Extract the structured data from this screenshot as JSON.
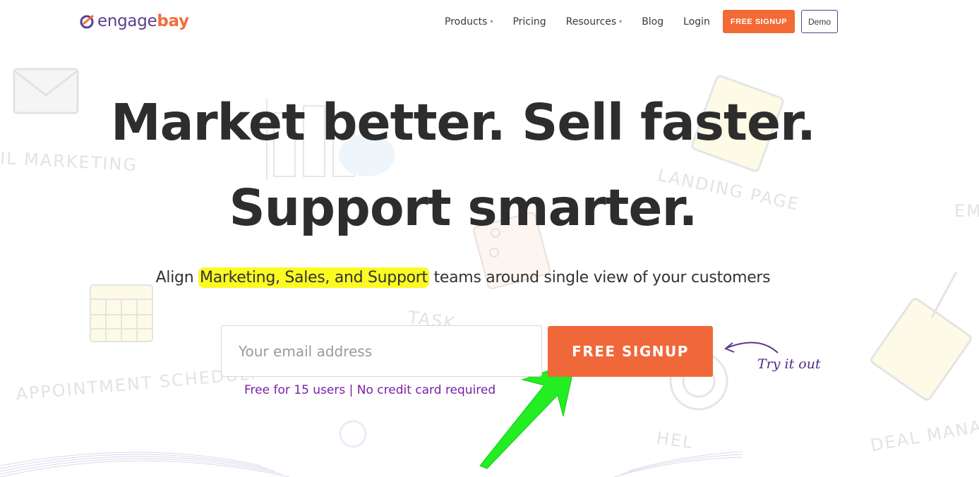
{
  "brand": {
    "name_part1": "engage",
    "name_part2": "bay"
  },
  "nav": {
    "items": [
      {
        "label": "Products",
        "dropdown": true
      },
      {
        "label": "Pricing",
        "dropdown": false
      },
      {
        "label": "Resources",
        "dropdown": true
      },
      {
        "label": "Blog",
        "dropdown": false
      },
      {
        "label": "Login",
        "dropdown": false
      }
    ],
    "caret": "▾",
    "signup_label": "FREE SIGNUP",
    "demo_label": "Demo"
  },
  "hero": {
    "headline_line1": "Market better. Sell faster.",
    "headline_line2": "Support smarter.",
    "sub_before": "Align ",
    "sub_highlight": "Marketing, Sales, and Support",
    "sub_after": " teams around single view of your customers",
    "email_placeholder": "Your email address",
    "cta_label": "FREE SIGNUP",
    "note": "Free for 15 users | No credit card required",
    "try_label": "Try it out"
  },
  "background_labels": {
    "email_marketing": "IL MARKETING",
    "landing_page": "LANDING PAGE",
    "appointment": "APPOINTMENT SCHEDULI",
    "task": "TASK",
    "help": "HEL",
    "deal": "DEAL MANAG",
    "em": "EM"
  },
  "colors": {
    "brand_purple": "#5a3f8e",
    "brand_orange": "#f26c3a",
    "cta_orange": "#f0673a",
    "highlight_yellow": "#fbfa22",
    "note_purple": "#7a1fa7",
    "annotation_arrow_green": "#22ee22"
  }
}
